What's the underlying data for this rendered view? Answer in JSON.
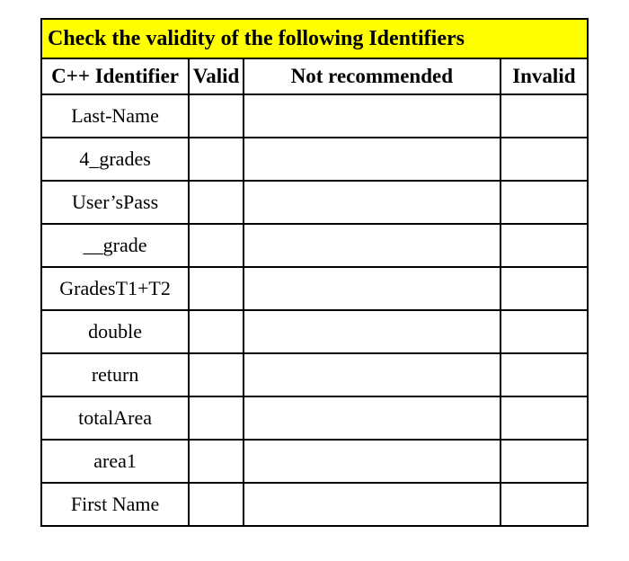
{
  "table": {
    "title": "Check the validity of the following Identifiers",
    "headers": {
      "identifier": "C++ Identifier",
      "valid": "Valid",
      "notRecommended": "Not recommended",
      "invalid": "Invalid"
    },
    "rows": [
      {
        "identifier": "Last-Name",
        "valid": "",
        "notRecommended": "",
        "invalid": ""
      },
      {
        "identifier": "4_grades",
        "valid": "",
        "notRecommended": "",
        "invalid": ""
      },
      {
        "identifier": "User’sPass",
        "valid": "",
        "notRecommended": "",
        "invalid": ""
      },
      {
        "identifier": "__grade",
        "valid": "",
        "notRecommended": "",
        "invalid": ""
      },
      {
        "identifier": "GradesT1+T2",
        "valid": "",
        "notRecommended": "",
        "invalid": ""
      },
      {
        "identifier": "double",
        "valid": "",
        "notRecommended": "",
        "invalid": ""
      },
      {
        "identifier": "return",
        "valid": "",
        "notRecommended": "",
        "invalid": ""
      },
      {
        "identifier": "totalArea",
        "valid": "",
        "notRecommended": "",
        "invalid": ""
      },
      {
        "identifier": "area1",
        "valid": "",
        "notRecommended": "",
        "invalid": ""
      },
      {
        "identifier": "First Name",
        "valid": "",
        "notRecommended": "",
        "invalid": ""
      }
    ]
  }
}
